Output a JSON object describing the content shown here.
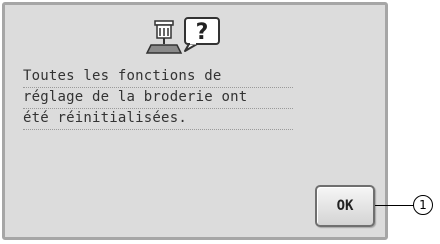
{
  "dialog": {
    "icon": "embroidery-machine-question-icon",
    "message_lines": [
      "Toutes les fonctions de",
      "réglage de la broderie ont",
      "été réinitialisées."
    ],
    "ok_label": "OK"
  },
  "callout": {
    "number": "1"
  },
  "colors": {
    "panel_bg": "#dcdcdc",
    "panel_border": "#a6a6a6",
    "text": "#333333"
  }
}
